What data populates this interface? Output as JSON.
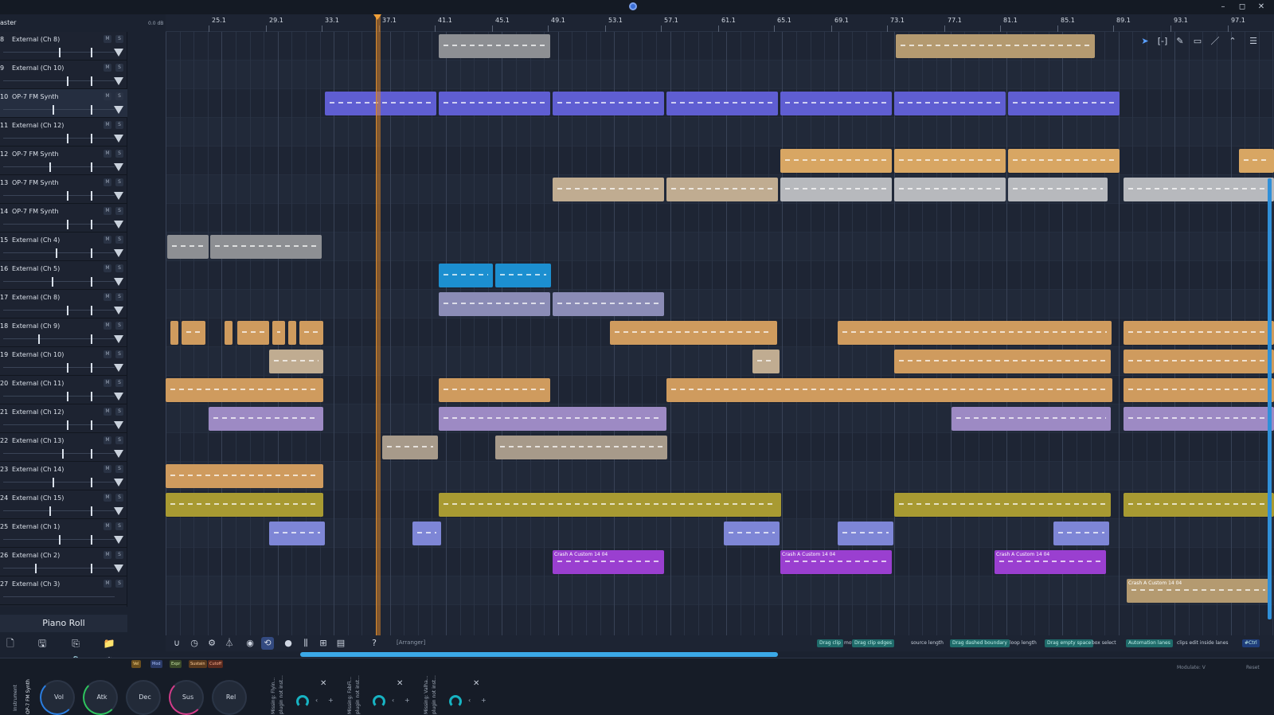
{
  "window": {
    "minimize": "–",
    "maximize": "◻",
    "close": "✕"
  },
  "master": {
    "label": "aster",
    "db": "0.0 dB"
  },
  "ruler": {
    "bars": [
      "25.1",
      "29.1",
      "33.1",
      "37.1",
      "41.1",
      "45.1",
      "49.1",
      "53.1",
      "57.1",
      "61.1",
      "65.1",
      "69.1",
      "73.1",
      "77.1",
      "81.1",
      "85.1",
      "89.1",
      "93.1",
      "97.1"
    ]
  },
  "tracks": [
    {
      "num": "8",
      "name": "External (Ch 8)"
    },
    {
      "num": "9",
      "name": "External (Ch 10)"
    },
    {
      "num": "10",
      "name": "OP-7 FM Synth"
    },
    {
      "num": "11",
      "name": "External (Ch 12)"
    },
    {
      "num": "12",
      "name": "OP-7 FM Synth"
    },
    {
      "num": "13",
      "name": "OP-7 FM Synth"
    },
    {
      "num": "14",
      "name": "OP-7 FM Synth"
    },
    {
      "num": "15",
      "name": "External (Ch 4)"
    },
    {
      "num": "16",
      "name": "External (Ch 5)"
    },
    {
      "num": "17",
      "name": "External (Ch 8)"
    },
    {
      "num": "18",
      "name": "External (Ch 9)"
    },
    {
      "num": "19",
      "name": "External (Ch 10)"
    },
    {
      "num": "20",
      "name": "External (Ch 11)"
    },
    {
      "num": "21",
      "name": "External (Ch 12)"
    },
    {
      "num": "22",
      "name": "External (Ch 13)"
    },
    {
      "num": "23",
      "name": "External (Ch 14)"
    },
    {
      "num": "24",
      "name": "External (Ch 15)"
    },
    {
      "num": "25",
      "name": "External (Ch 1)"
    },
    {
      "num": "26",
      "name": "External (Ch 2)"
    },
    {
      "num": "27",
      "name": "External (Ch 3)"
    }
  ],
  "track_buttons": {
    "mute": "M",
    "solo": "S"
  },
  "clips": {
    "crash": "Crash A Custom 14 04"
  },
  "bottom_toolbar": {
    "arranger_label": "[Arranger]",
    "help": "?"
  },
  "hints": [
    {
      "tag": "Drag clip",
      "text": "move"
    },
    {
      "tag": "Drag clip edges",
      "text": "source length"
    },
    {
      "tag": "Drag dashed boundary",
      "text": "loop length"
    },
    {
      "tag": "Drag empty space",
      "text": "box select"
    },
    {
      "tag": "Automation lanes",
      "text": "clips edit inside lanes"
    }
  ],
  "hint_end": "#Ctrl",
  "piano_roll": {
    "label": "Piano Roll"
  },
  "side_buttons": {
    "new": "🗋",
    "save": "🖫",
    "export": "⎘",
    "folder": "📁",
    "play": "▷",
    "route": "⑂",
    "lock": "🔒",
    "settings": "⚙"
  },
  "mod_tags": [
    "Vel",
    "Mod",
    "Expr",
    "Sustain",
    "Cutoff"
  ],
  "instrument": {
    "vertical": "Instrument",
    "name": "OP-7 FM Synth"
  },
  "knobs": [
    "Vol",
    "Atk",
    "Dec",
    "Sus",
    "Rel"
  ],
  "plugins": [
    {
      "label": "Missing: Flyin...",
      "sub": "plugin not inst..."
    },
    {
      "label": "Missing: FabFi...",
      "sub": "plugin not inst..."
    },
    {
      "label": "Missing: Valha...",
      "sub": "plugin not inst..."
    }
  ],
  "modulate_label": "Modulate: V",
  "reset_label": "Reset",
  "colors": {
    "playhead": "#d98a2e",
    "accent": "#3ba9e8",
    "clip_blue": "#5f5ed2",
    "clip_gold": "#d8a663",
    "clip_magenta": "#9a3fd0",
    "clip_olive": "#a89a32"
  }
}
